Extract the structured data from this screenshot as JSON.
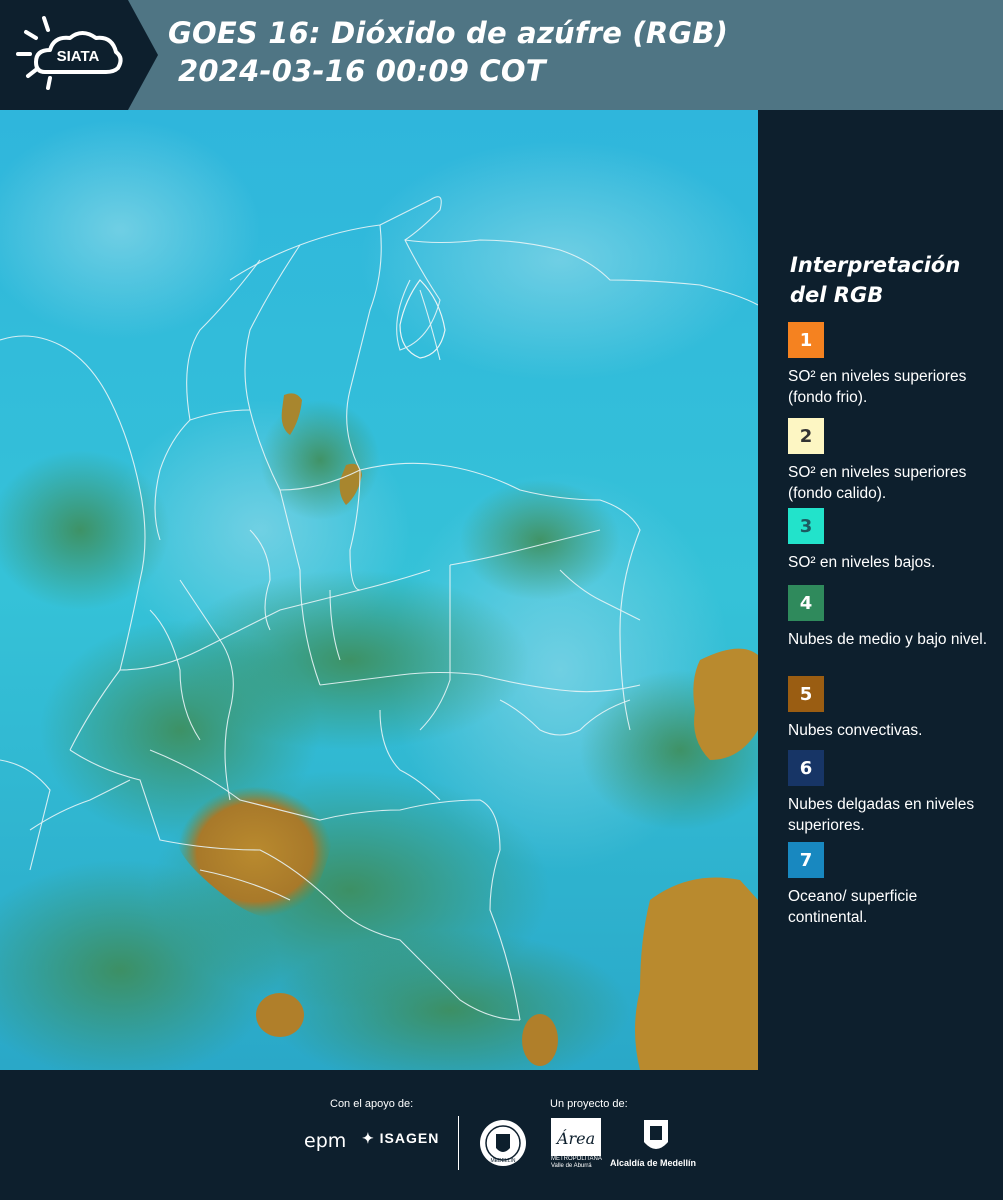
{
  "header": {
    "logo_text": "SIATA",
    "title_line1": "GOES 16: Dióxido de azúfre (RGB)",
    "title_line2": "2024-03-16 00:09 COT",
    "background_color": "#4f7584",
    "logo_background_color": "#0d1f2d"
  },
  "map": {
    "description_icon": "satellite-map",
    "ocean_color": "#24b4d8",
    "continental_color": "#3fc8d8"
  },
  "legend": {
    "title": "Interpretación del RGB",
    "items": [
      {
        "number": "1",
        "color": "#f58220",
        "number_color": "#ffffff",
        "label": "SO² en niveles superiores (fondo frio)."
      },
      {
        "number": "2",
        "color": "#fdf6c3",
        "number_color": "#333333",
        "label": "SO² en niveles superiores (fondo calido)."
      },
      {
        "number": "3",
        "color": "#22e3cb",
        "number_color": "#1c5a60",
        "label": "SO² en niveles bajos."
      },
      {
        "number": "4",
        "color": "#2f8a5c",
        "number_color": "#ffffff",
        "label": "Nubes de medio y bajo nivel."
      },
      {
        "number": "5",
        "color": "#9a5d12",
        "number_color": "#ffffff",
        "label": "Nubes convectivas."
      },
      {
        "number": "6",
        "color": "#173566",
        "number_color": "#ffffff",
        "label": "Nubes delgadas en niveles superiores."
      },
      {
        "number": "7",
        "color": "#1888c0",
        "number_color": "#ffffff",
        "label": "Oceano/ superficie continental."
      }
    ]
  },
  "footer": {
    "support_label": "Con el apoyo de:",
    "project_label": "Un proyecto de:",
    "epm_logo_text": "epm",
    "isagen_logo_text": "ISAGEN",
    "area_logo_text": "Área",
    "area_subtext": "METROPOLITANA Valle de Aburrá",
    "alcaldia_label": "Alcaldía de Medellín",
    "univ_logo_text": "MEDELLIN"
  }
}
